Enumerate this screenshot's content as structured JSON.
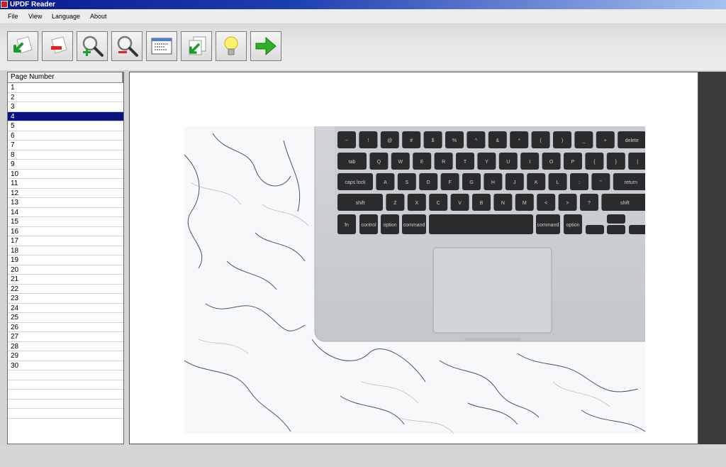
{
  "window": {
    "title": "UPDF Reader"
  },
  "menu": {
    "items": [
      "File",
      "View",
      "Language",
      "About"
    ]
  },
  "toolbar": {
    "buttons": [
      {
        "icon": "import-page-icon"
      },
      {
        "icon": "remove-page-icon"
      },
      {
        "icon": "zoom-in-icon"
      },
      {
        "icon": "zoom-out-icon"
      },
      {
        "icon": "window-view-icon"
      },
      {
        "icon": "copy-pages-icon"
      },
      {
        "icon": "lightbulb-icon"
      },
      {
        "icon": "next-arrow-icon"
      }
    ]
  },
  "pagelist": {
    "header": "Page Number",
    "pages": [
      "1",
      "2",
      "3",
      "4",
      "5",
      "6",
      "7",
      "8",
      "9",
      "10",
      "11",
      "12",
      "13",
      "14",
      "15",
      "16",
      "17",
      "18",
      "19",
      "20",
      "21",
      "22",
      "23",
      "24",
      "25",
      "26",
      "27",
      "28",
      "29",
      "30"
    ],
    "selected": "4"
  },
  "keyboard": {
    "row1": [
      "~",
      "!",
      "@",
      "#",
      "$",
      "%",
      "^",
      "&",
      "*",
      "(",
      ")",
      "_",
      "+",
      "delete"
    ],
    "row2": [
      "tab",
      "Q",
      "W",
      "E",
      "R",
      "T",
      "Y",
      "U",
      "I",
      "O",
      "P",
      "{",
      "}",
      "|"
    ],
    "row3": [
      "caps lock",
      "A",
      "S",
      "D",
      "F",
      "G",
      "H",
      "J",
      "K",
      "L",
      ":",
      "\"",
      "return"
    ],
    "row4": [
      "shift",
      "Z",
      "X",
      "C",
      "V",
      "B",
      "N",
      "M",
      "<",
      ">",
      "?",
      "shift"
    ],
    "row5": [
      "fn",
      "control",
      "option",
      "command",
      "command",
      "option"
    ]
  }
}
